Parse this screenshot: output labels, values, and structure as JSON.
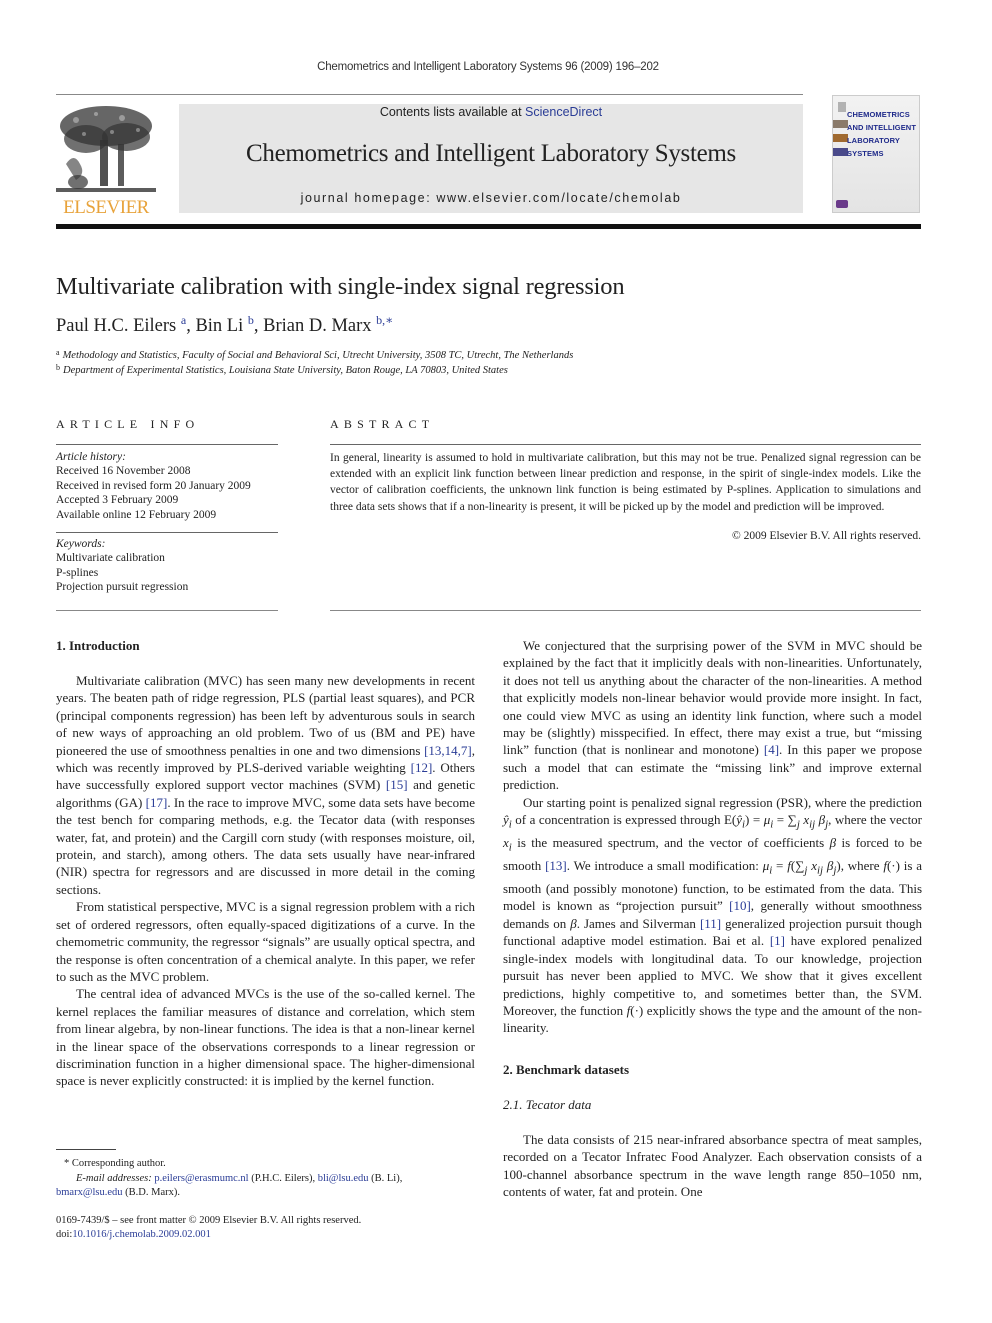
{
  "running_head": "Chemometrics and Intelligent Laboratory Systems 96 (2009) 196–202",
  "header": {
    "publisher_logo_text": "ELSEVIER",
    "contents_prefix": "Contents lists available at ",
    "contents_link": "ScienceDirect",
    "journal_title": "Chemometrics and Intelligent Laboratory Systems",
    "homepage_label": "journal homepage: www.elsevier.com/locate/chemolab",
    "cover_lines": [
      "CHEMOMETRICS",
      "AND INTELLIGENT",
      "LABORATORY",
      "SYSTEMS"
    ]
  },
  "article": {
    "title": "Multivariate calibration with single-index signal regression",
    "authors": [
      {
        "name": "Paul H.C. Eilers",
        "sup": "a"
      },
      {
        "name": "Bin Li",
        "sup": "b"
      },
      {
        "name": "Brian D. Marx",
        "sup": "b,∗"
      }
    ],
    "affiliations": [
      {
        "sup": "a",
        "text": "Methodology and Statistics, Faculty of Social and Behavioral Sci, Utrecht University, 3508 TC, Utrecht, The Netherlands"
      },
      {
        "sup": "b",
        "text": "Department of Experimental Statistics, Louisiana State University, Baton Rouge, LA 70803, United States"
      }
    ]
  },
  "article_info": {
    "heading": "ARTICLE INFO",
    "history_label": "Article history:",
    "history": [
      "Received 16 November 2008",
      "Received in revised form 20 January 2009",
      "Accepted 3 February 2009",
      "Available online 12 February 2009"
    ],
    "keywords_label": "Keywords:",
    "keywords": [
      "Multivariate calibration",
      "P-splines",
      "Projection pursuit regression"
    ]
  },
  "abstract": {
    "heading": "ABSTRACT",
    "text": "In general, linearity is assumed to hold in multivariate calibration, but this may not be true. Penalized signal regression can be extended with an explicit link function between linear prediction and response, in the spirit of single-index models. Like the vector of calibration coefficients, the unknown link function is being estimated by P-splines. Application to simulations and three data sets shows that if a non-linearity is present, it will be picked up by the model and prediction will be improved.",
    "copyright": "© 2009 Elsevier B.V. All rights reserved."
  },
  "body": {
    "section1_heading": "1. Introduction",
    "left": {
      "p1": {
        "a": "Multivariate calibration (MVC) has seen many new developments in recent years. The beaten path of ridge regression, PLS (partial least squares), and PCR (principal components regression) has been left by adventurous souls in search of new ways of approaching an old problem. Two of us (BM and PE) have pioneered the use of smoothness penalties in one and two dimensions ",
        "ref1": "[13,14,7]",
        "b": ", which was recently improved by PLS-derived variable weighting ",
        "ref2": "[12]",
        "c": ". Others have successfully explored support vector machines (SVM) ",
        "ref3": "[15]",
        "d": " and genetic algorithms (GA) ",
        "ref4": "[17]",
        "e": ". In the race to improve MVC, some data sets have become the test bench for comparing methods, e.g. the Tecator data (with responses water, fat, and protein) and the Cargill corn study (with responses moisture, oil, protein, and starch), among others. The data sets usually have near-infrared (NIR) spectra for regressors and are discussed in more detail in the coming sections."
      },
      "p2": "From statistical perspective, MVC is a signal regression problem with a rich set of ordered regressors, often equally-spaced digitizations of a curve. In the chemometric community, the regressor “signals” are usually optical spectra, and the response is often concentration of a chemical analyte. In this paper, we refer to such as the MVC problem.",
      "p3": "The central idea of advanced MVCs is the use of the so-called kernel. The kernel replaces the familiar measures of distance and correlation, which stem from linear algebra, by non-linear functions. The idea is that a non-linear kernel in the linear space of the observations corresponds to a linear regression or discrimination function in a higher dimensional space. The higher-dimensional space is never explicitly constructed: it is implied by the kernel function."
    },
    "right": {
      "p1": {
        "a": "We conjectured that the surprising power of the SVM in MVC should be explained by the fact that it implicitly deals with non-linearities. Unfortunately, it does not tell us anything about the character of the non-linearities. A method that explicitly models non-linear behavior would provide more insight. In fact, one could view MVC as using an identity link function, where such a model may be (slightly) misspecified. In effect, there may exist a true, but “missing link” function (that is nonlinear and monotone) ",
        "ref1": "[4]",
        "b": ". In this paper we propose such a model that can estimate the “missing link” and improve external prediction."
      },
      "p2": {
        "a": "Our starting point is penalized signal regression (PSR), where the prediction ",
        "m1": "ŷ",
        "m1sub": "i",
        "b": " of a concentration is expressed through E(",
        "m2": "ŷ",
        "m2sub": "i",
        "c": ") = ",
        "m3": "μ",
        "m3sub": "i",
        "d": " = ∑",
        "dsub": "j",
        "e": " ",
        "m4": "x",
        "m4sub": "ij",
        "f": " ",
        "m5": "β",
        "m5sub": "j",
        "g": ", where the vector ",
        "m6": "x",
        "m6sub": "i",
        "h": " is the measured spectrum, and the vector of coefficients ",
        "m7": "β",
        "i": " is forced to be smooth ",
        "ref1": "[13]",
        "j": ". We introduce a small modification: ",
        "m8": "μ",
        "m8sub": "i",
        "k": " = ",
        "m9": "f",
        "l": "(∑",
        "lsub": "j",
        "m": " ",
        "m10": "x",
        "m10sub": "ij",
        "n": " ",
        "m11": "β",
        "m11sub": "j",
        "o": "), where ",
        "m12": "f",
        "p": "(·) is a smooth (and possibly monotone) function, to be estimated from the data. This model is known as “projection pursuit” ",
        "ref2": "[10]",
        "q": ", generally without smoothness demands on ",
        "m13": "β",
        "r": ". James and Silverman ",
        "ref3": "[11]",
        "s": " generalized projection pursuit though functional adaptive model estimation. Bai et al. ",
        "ref4": "[1]",
        "t": " have explored penalized single-index models with longitudinal data. To our knowledge, projection pursuit has never been applied to MVC. We show that it gives excellent predictions, highly competitive to, and sometimes better than, the SVM. Moreover, the function ",
        "m14": "f",
        "u": "(·) explicitly shows the type and the amount of the non-linearity."
      },
      "section2_heading": "2. Benchmark datasets",
      "section21_heading": "2.1. Tecator data",
      "p3": "The data consists of 215 near-infrared absorbance spectra of meat samples, recorded on a Tecator Infratec Food Analyzer. Each observation consists of a 100-channel absorbance spectrum in the wave length range 850–1050 nm, contents of water, fat and protein. One"
    }
  },
  "footnotes": {
    "corresponding": "* Corresponding author.",
    "email_label": "E-mail addresses:",
    "emails": [
      {
        "addr": "p.eilers@erasmumc.nl",
        "who": " (P.H.C. Eilers), "
      },
      {
        "addr": "bli@lsu.edu",
        "who": " (B. Li),"
      },
      {
        "addr": "bmarx@lsu.edu",
        "who": " (B.D. Marx)."
      }
    ],
    "frontmatter": "0169-7439/$ – see front matter © 2009 Elsevier B.V. All rights reserved.",
    "doi_label": "doi:",
    "doi": "10.1016/j.chemolab.2009.02.001"
  },
  "colors": {
    "link": "#2a3c96",
    "elsevier_orange": "#e8a33b",
    "banner_bg": "#e6e6e6"
  }
}
